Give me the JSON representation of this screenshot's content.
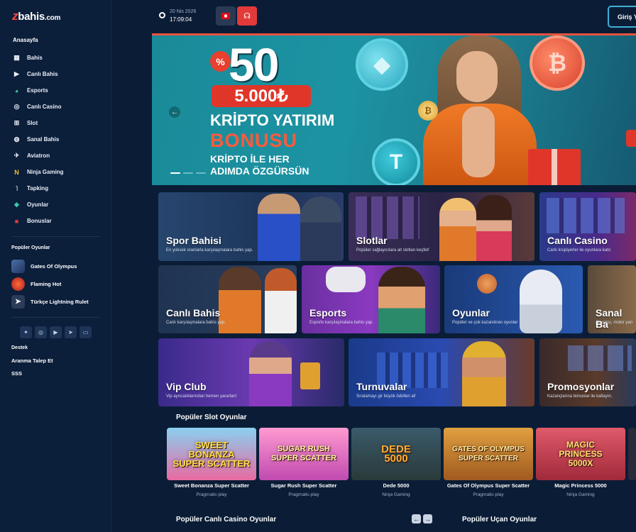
{
  "brand": {
    "logo_z": "z",
    "logo_text": "bahis",
    "logo_domain": ".com"
  },
  "sidebar": {
    "heading": "Anasayfa",
    "items": [
      {
        "label": "Bahis",
        "icon": "grid-icon"
      },
      {
        "label": "Canlı Bahis",
        "icon": "live-tv-icon"
      },
      {
        "label": "Esports",
        "icon": "gamepad-icon"
      },
      {
        "label": "Canlı Casino",
        "icon": "chips-icon"
      },
      {
        "label": "Slot",
        "icon": "slot-machine-icon"
      },
      {
        "label": "Sanal Bahis",
        "icon": "virtual-icon"
      },
      {
        "label": "Aviatron",
        "icon": "plane-icon"
      },
      {
        "label": "Ninja Gaming",
        "icon": "ninja-icon"
      },
      {
        "label": "Tapking",
        "icon": "tap-icon"
      },
      {
        "label": "Oyunlar",
        "icon": "games-icon"
      },
      {
        "label": "Bonuslar",
        "icon": "gift-icon"
      }
    ],
    "popular_heading": "Popüler Oyunlar",
    "popular": [
      {
        "label": "Gates Of Olympus",
        "color": "#2c4a7a"
      },
      {
        "label": "Flaming Hot",
        "color": "#c8302a"
      },
      {
        "label": "Türkçe Lightning Rulet",
        "color": "#2b3c5a"
      }
    ],
    "socials": [
      "twitter-icon",
      "instagram-icon",
      "youtube-icon",
      "telegram-icon",
      "tv-icon"
    ],
    "support_heading": "Destek",
    "support_links": [
      "Aranma Talep Et",
      "SSS"
    ]
  },
  "topbar": {
    "date": "20 Nis 2026",
    "time": "17:09:04",
    "login_label": "Giriş Y"
  },
  "hero": {
    "percent": "%",
    "big_number": "50",
    "amount": "5.000₺",
    "line1": "KRİPTO YATIRIM",
    "line2": "BONUSU",
    "line3": "KRİPTO İLE HER ADIMDA ÖZGÜRSÜN",
    "prev": "←",
    "coins": {
      "eth": "◆",
      "usdt": "T",
      "btc": "₿",
      "gold": "₿"
    }
  },
  "categories": [
    {
      "title": "Spor Bahisi",
      "subtitle": "En yüksek oranlarla karşılaşmalara bahis yap."
    },
    {
      "title": "Slotlar",
      "subtitle": "Popüler sağlayıcılara ait slotları keşfet!"
    },
    {
      "title": "Canlı Casino",
      "subtitle": "Canlı krupiyerler ile oyunlara katıl."
    },
    {
      "title": "Canlı Bahis",
      "subtitle": "Canlı karşılaşmalara bahis yap."
    },
    {
      "title": "Esports",
      "subtitle": "Esports karşılaşmalara bahis yap."
    },
    {
      "title": "Oyunlar",
      "subtitle": "Popüler ve çok kazandıran oyunlar"
    },
    {
      "title": "Sanal Ba",
      "subtitle": "At yarışı, motor yarı"
    },
    {
      "title": "Vip Club",
      "subtitle": "Vip ayrıcalıklarından hemen yararlan!"
    },
    {
      "title": "Turnuvalar",
      "subtitle": "Sıralamayı gir büyük ödülleri al!"
    },
    {
      "title": "Promosyonlar",
      "subtitle": "Kazançlarına bonuslar ile katlayın."
    }
  ],
  "popular_slots": {
    "title": "Popüler Slot Oyunlar",
    "games": [
      {
        "art": "SWEET BONANZA SUPER SCATTER",
        "name": "Sweet Bonanza Super Scatter",
        "provider": "Pragmatic-play"
      },
      {
        "art": "SUGAR RUSH SUPER SCATTER",
        "name": "Sugar Rush Super Scatter",
        "provider": "Pragmatic-play"
      },
      {
        "art": "DEDE 5000",
        "name": "Dede 5000",
        "provider": "Ninja Gaming"
      },
      {
        "art": "GATES OF OLYMPUS SUPER SCATTER",
        "name": "Gates Of Olympus Super Scatter",
        "provider": "Pragmatic-play"
      },
      {
        "art": "MAGIC PRINCESS 5000X",
        "name": "Magic Princess 5000",
        "provider": "Ninja Gaming"
      }
    ]
  },
  "live_casino": {
    "title": "Popüler Canlı Casino Oyunlar",
    "prev": "←",
    "next": "→"
  },
  "crash_games": {
    "title": "Popüler Uçan Oyunlar"
  }
}
